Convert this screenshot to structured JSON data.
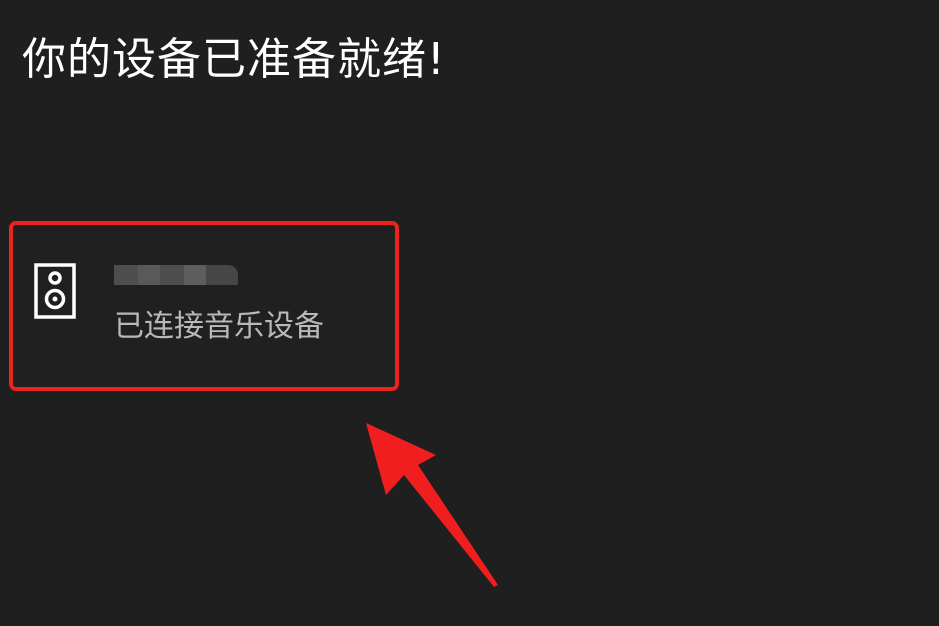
{
  "page": {
    "title": "你的设备已准备就绪!"
  },
  "device": {
    "icon": "speaker-icon",
    "name_redacted": true,
    "status": "已连接音乐设备"
  },
  "annotation": {
    "highlight_color": "#e8241c",
    "arrow_color": "#f01e1e"
  },
  "colors": {
    "background": "#1f1f1f",
    "title_text": "#ffffff",
    "status_text": "#b9b9b9",
    "icon": "#ffffff"
  }
}
